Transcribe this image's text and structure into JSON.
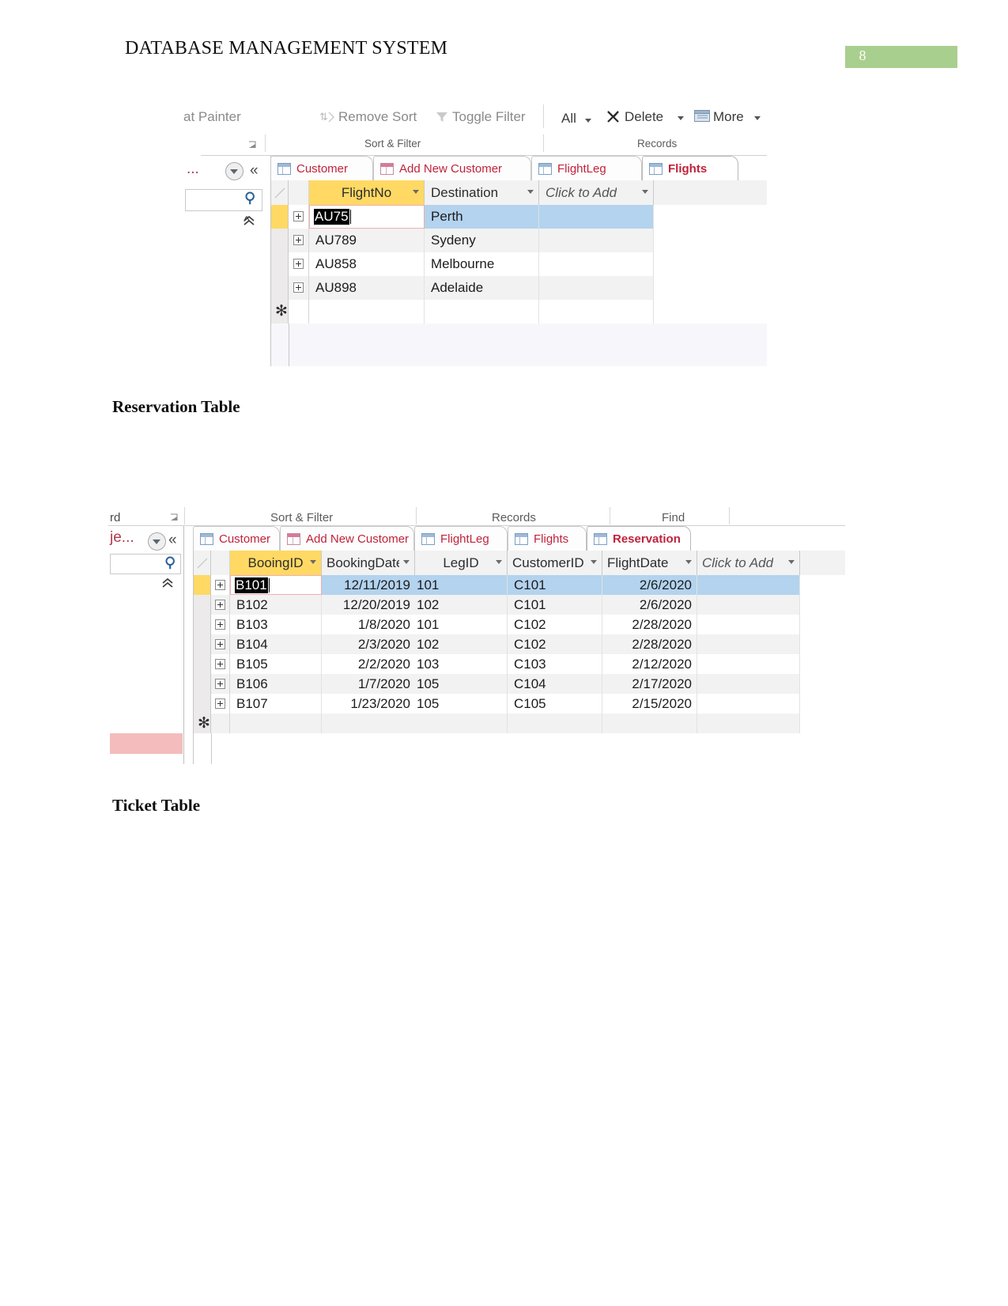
{
  "page": {
    "doc_title": "DATABASE MANAGEMENT SYSTEM",
    "page_number": "8"
  },
  "headings": {
    "reservation": "Reservation Table",
    "ticket": "Ticket Table"
  },
  "flights_shot": {
    "ribbon": {
      "commands": [
        "at Painter",
        "Remove Sort",
        "Toggle Filter",
        "All",
        "Delete",
        "More"
      ],
      "groups": [
        "Sort & Filter",
        "Records"
      ]
    },
    "nav_pane": {
      "title": "...",
      "dropdown_icon": "chevron-down-circle-icon",
      "collapse_icon": "double-chevron-left-icon",
      "search_placeholder": "",
      "search_icon": "magnifier-icon",
      "chevron_up_icon": "double-chevron-up-icon"
    },
    "tabs": [
      {
        "label": "Customer",
        "icon": "table-icon",
        "active": false
      },
      {
        "label": "Add New Customer",
        "icon": "form-icon",
        "active": false
      },
      {
        "label": "FlightLeg",
        "icon": "table-icon",
        "active": false
      },
      {
        "label": "Flights",
        "icon": "table-icon",
        "active": true
      }
    ],
    "grid": {
      "columns": [
        "FlightNo",
        "Destination",
        "Click to Add"
      ],
      "rows": [
        {
          "FlightNo": "AU75",
          "Destination": "Perth",
          "selected": true,
          "editing": true
        },
        {
          "FlightNo": "AU789",
          "Destination": "Sydeny",
          "selected": false,
          "editing": false
        },
        {
          "FlightNo": "AU858",
          "Destination": "Melbourne",
          "selected": false,
          "editing": false
        },
        {
          "FlightNo": "AU898",
          "Destination": "Adelaide",
          "selected": false,
          "editing": false
        }
      ],
      "new_row_marker": "✻"
    }
  },
  "reservation_shot": {
    "ribbon": {
      "commands": [
        "rd"
      ],
      "groups": [
        "Sort & Filter",
        "Records",
        "Find"
      ]
    },
    "nav_pane": {
      "title": "je...",
      "dropdown_icon": "chevron-down-circle-icon",
      "collapse_icon": "double-chevron-left-icon",
      "search_placeholder": "",
      "search_icon": "magnifier-icon",
      "chevron_up_icon": "double-chevron-up-icon"
    },
    "tabs": [
      {
        "label": "Customer",
        "icon": "table-icon",
        "active": false
      },
      {
        "label": "Add New Customer",
        "icon": "form-icon",
        "active": false
      },
      {
        "label": "FlightLeg",
        "icon": "table-icon",
        "active": false
      },
      {
        "label": "Flights",
        "icon": "table-icon",
        "active": false
      },
      {
        "label": "Reservation",
        "icon": "table-icon",
        "active": true
      }
    ],
    "grid": {
      "columns": [
        "BooingID",
        "BookingDate",
        "LegID",
        "CustomerID",
        "FlightDate",
        "Click to Add"
      ],
      "rows": [
        {
          "BooingID": "B101",
          "BookingDate": "12/11/2019",
          "LegID": "101",
          "CustomerID": "C101",
          "FlightDate": "2/6/2020",
          "selected": true,
          "editing": true
        },
        {
          "BooingID": "B102",
          "BookingDate": "12/20/2019",
          "LegID": "102",
          "CustomerID": "C101",
          "FlightDate": "2/6/2020",
          "selected": false,
          "editing": false
        },
        {
          "BooingID": "B103",
          "BookingDate": "1/8/2020",
          "LegID": "101",
          "CustomerID": "C102",
          "FlightDate": "2/28/2020",
          "selected": false,
          "editing": false
        },
        {
          "BooingID": "B104",
          "BookingDate": "2/3/2020",
          "LegID": "102",
          "CustomerID": "C102",
          "FlightDate": "2/28/2020",
          "selected": false,
          "editing": false
        },
        {
          "BooingID": "B105",
          "BookingDate": "2/2/2020",
          "LegID": "103",
          "CustomerID": "C103",
          "FlightDate": "2/12/2020",
          "selected": false,
          "editing": false
        },
        {
          "BooingID": "B106",
          "BookingDate": "1/7/2020",
          "LegID": "105",
          "CustomerID": "C104",
          "FlightDate": "2/17/2020",
          "selected": false,
          "editing": false
        },
        {
          "BooingID": "B107",
          "BookingDate": "1/23/2020",
          "LegID": "105",
          "CustomerID": "C105",
          "FlightDate": "2/15/2020",
          "selected": false,
          "editing": false
        }
      ],
      "new_row_marker": "✻"
    }
  },
  "colors": {
    "page_number_bg": "#a9cf8f",
    "tab_label": "#c0223b",
    "key_column": "#ffd964",
    "selected_row": "#b3d3ee",
    "edit_border": "#f0aeae",
    "pink_bar": "#f4bcbc"
  }
}
